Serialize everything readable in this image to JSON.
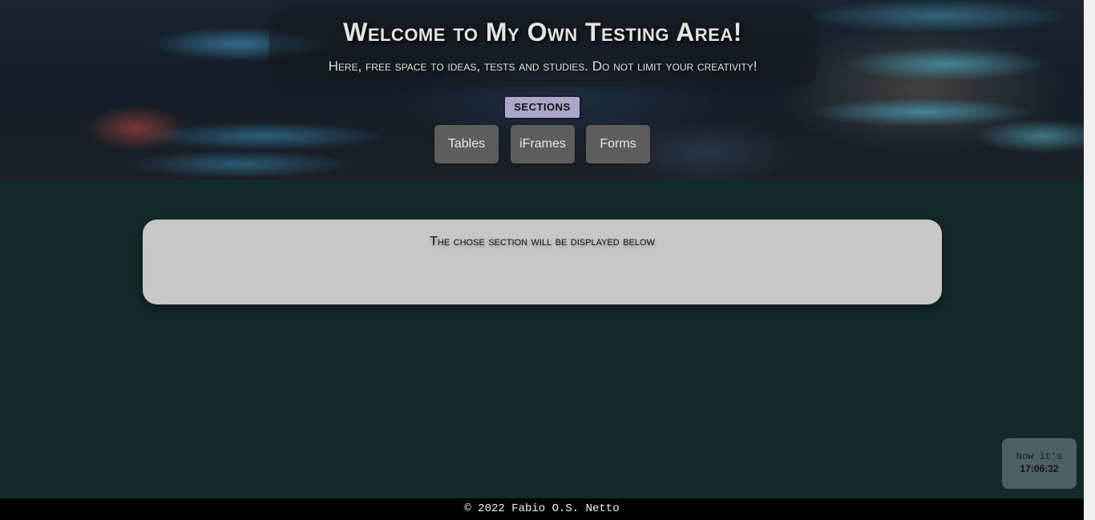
{
  "header": {
    "title": "Welcome to My Own Testing Area!",
    "subtitle": "Here, free space to ideas, tests and studies. Do not limit your creativity!"
  },
  "nav": {
    "sections_label": "SECTIONS",
    "items": [
      {
        "label": "Tables"
      },
      {
        "label": "iFrames"
      },
      {
        "label": "Forms"
      }
    ]
  },
  "main": {
    "placeholder_text": "The chose section will be displayed below"
  },
  "clock": {
    "label": "Now it's",
    "time": "17:06:32"
  },
  "footer": {
    "text": "© 2022 Fabio O.S. Netto"
  },
  "colors": {
    "page_background": "#132a2b",
    "card_background": "#c8c7c7",
    "sections_badge": "#a9a6c8",
    "nav_button": "#5d5d5d",
    "clock_background": "#4c6163",
    "footer_background": "#000000"
  }
}
